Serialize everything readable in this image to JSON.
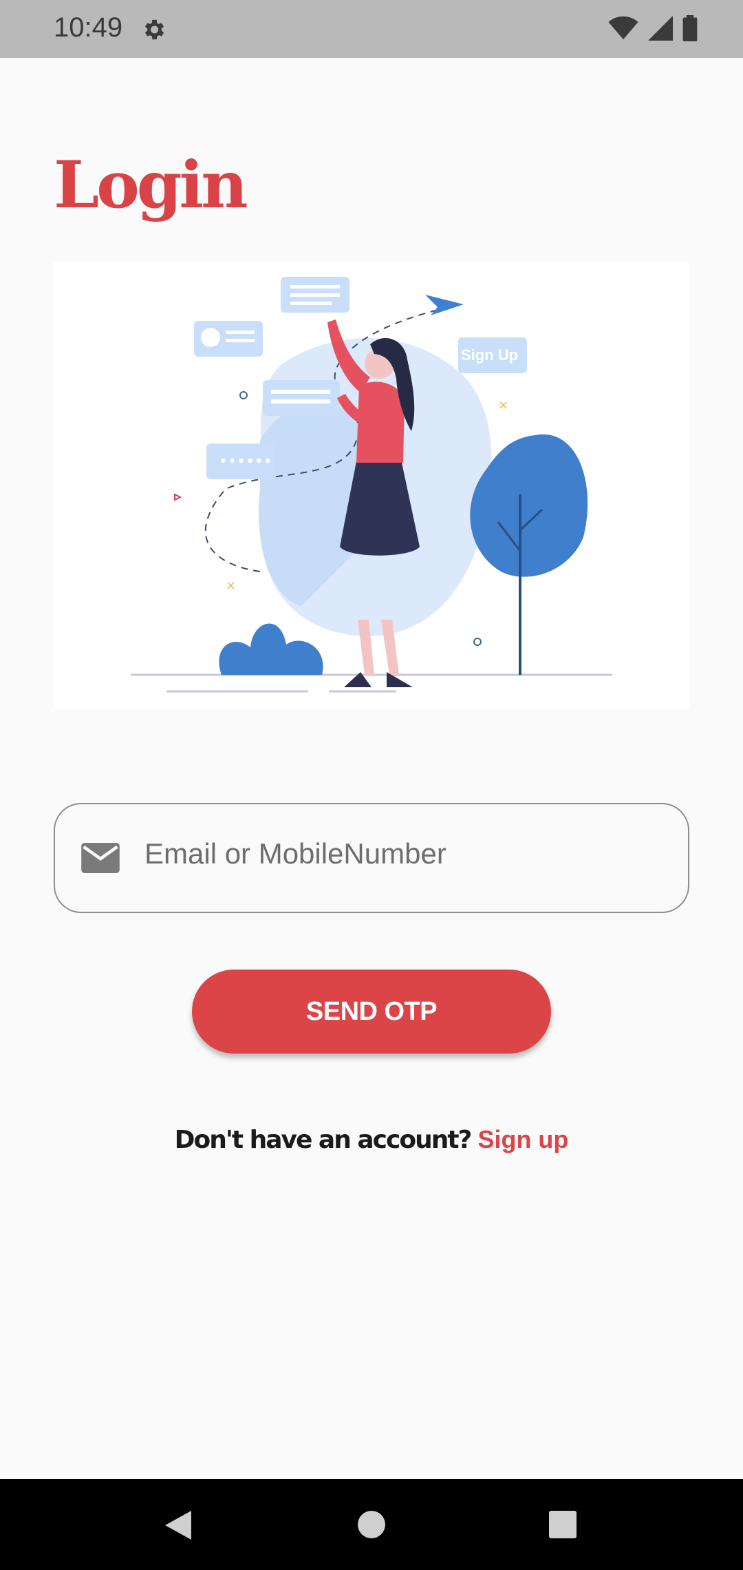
{
  "status_bar": {
    "time": "10:49",
    "icons": [
      "settings-gear-icon",
      "wifi-icon",
      "signal-icon",
      "battery-icon"
    ]
  },
  "page": {
    "title": "Login"
  },
  "illustration": {
    "chip_text": "Sign Up"
  },
  "login_form": {
    "input_placeholder": "Email or MobileNumber",
    "input_icon": "mail-icon",
    "send_otp_label": "SEND OTP"
  },
  "signup": {
    "question": "Don't have an account?",
    "link": "Sign up"
  },
  "colors": {
    "accent": "#db4548",
    "status_bar": "#b9b9b9",
    "background": "#fafafa"
  },
  "nav_bar": {
    "buttons": [
      "back-icon",
      "home-icon",
      "recents-icon"
    ]
  }
}
